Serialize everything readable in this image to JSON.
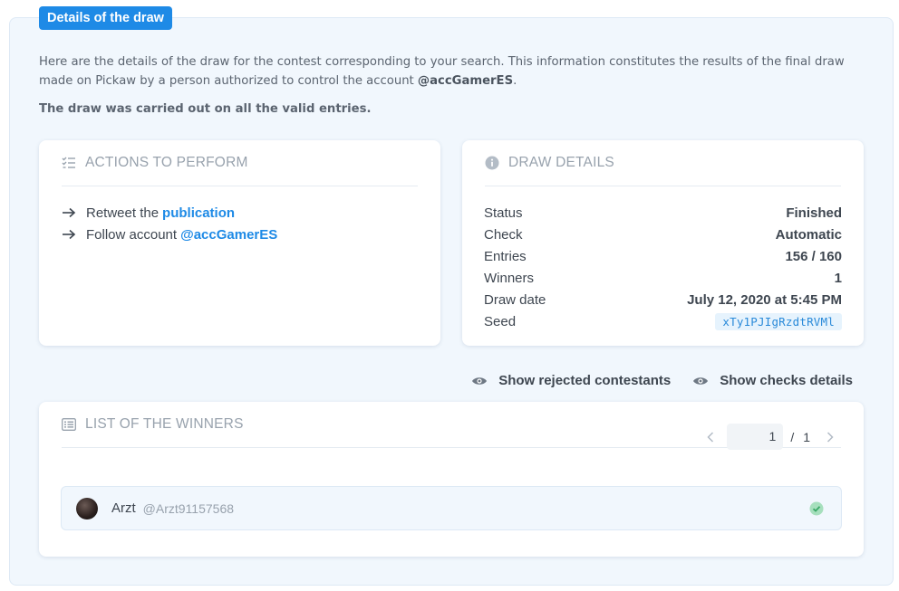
{
  "legend": "Details of the draw",
  "intro": {
    "text": "Here are the details of the draw for the contest corresponding to your search. This information constitutes the results of the final draw made on Pickaw by a person authorized to control the account ",
    "account": "@accGamerES",
    "end": "."
  },
  "scope_note": "The draw was carried out on all the valid entries.",
  "actions": {
    "title": "ACTIONS TO PERFORM",
    "icon": "checklist-icon",
    "items": [
      {
        "prefix": "Retweet the",
        "link": "publication"
      },
      {
        "prefix": "Follow account",
        "link": "@accGamerES"
      }
    ]
  },
  "draw": {
    "title": "DRAW DETAILS",
    "icon": "info-icon",
    "rows": [
      {
        "label": "Status",
        "value": "Finished"
      },
      {
        "label": "Check",
        "value": "Automatic"
      },
      {
        "label": "Entries",
        "value": "156 / 160"
      },
      {
        "label": "Winners",
        "value": "1"
      },
      {
        "label": "Draw date",
        "value": "July 12, 2020 at 5:45 PM"
      },
      {
        "label": "Seed",
        "value": "xTy1PJIgRzdtRVMl"
      }
    ]
  },
  "toggles": {
    "rejected": "Show rejected contestants",
    "checks": "Show checks details"
  },
  "winners": {
    "title": "LIST OF THE WINNERS",
    "icon": "list-icon",
    "pager": {
      "current": "1",
      "separator": "/",
      "total": "1"
    },
    "list": [
      {
        "name": "Arzt",
        "handle": "@Arzt91157568",
        "verified": true
      }
    ]
  },
  "colors": {
    "accent": "#1e8ae6",
    "panel_bg": "#f1f7fd",
    "muted": "#98a2ad",
    "success": "#5cc689"
  }
}
